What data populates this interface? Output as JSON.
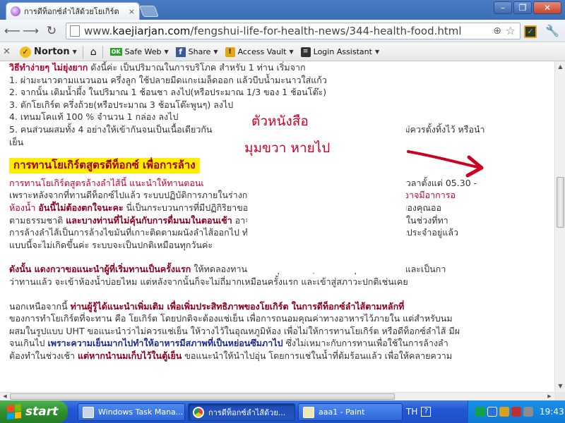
{
  "browser": {
    "tab_title": "การดีท็อกซ์ลำไส้ด้วยโยเกิร์ต",
    "tab_close": "×",
    "url_scheme": "www.",
    "url_host": "kaejiarjan.com",
    "url_path": "/fengshui-life-for-health-news/344-health-food.html",
    "win_min": "–",
    "win_max": "❐",
    "win_close": "✕"
  },
  "norton_toolbar": {
    "close": "✕",
    "brand": "Norton",
    "safe_web": "Safe Web",
    "share": "Share",
    "access_vault": "Access Vault",
    "login_assistant": "Login Assistant",
    "ok_badge": "OK",
    "fb_badge": "f"
  },
  "content": {
    "intro_lead": "วิธีทำง่ายๆ ไม่ยุ่งยาก",
    "intro_rest": " ดังนี้ค่ะ เป็นปริมาณในการบริโภค สำหรับ 1 ท่าน เริ่มจาก",
    "step1": "1. ผ่ามะนาวตามแนวนอน ครึ่งลูก ใช้ปลายมีดแกะเมล็ดออก แล้วบีบน้ำมะนาวใส่แก้ว",
    "step2": "2. จากนั้น เติมน้ำผึ้ง ในปริมาณ 1 ช้อนชา ลงไป(หรือประมาณ 1/3 ของ 1 ช้อนโต๊ะ)",
    "step3": "3. ตักโยเกิร์ต ครึ่งถ้วย(หรือประมาณ 3 ช้อนโต๊ะพูนๆ) ลงไป",
    "step4": "4. เทนมโคแท้ 100 % จำนวน 1 กล่อง ลงไป",
    "step5": "5. คนส่วนผสมทั้ง 4 อย่างให้เข้ากันจนเป็นเนื้อเดียวกัน",
    "step5_tail": "รทานทันทีไม่ควรตั้งทิ้งไว้ หรือนำ",
    "step5_cont": "เย็น",
    "heading": "การทานโยเกิร์ตสูตรดีท็อกซ์  เพื่อการล้าง",
    "p2_l1_a": "การทานโยเกิร์ตสูตรล้างลำไส้นี้  แนะนำให้ทานตอนเ",
    "p2_l1_b": "นแล้ว  ช่วงเวลาตั้งแต่  05.30 -",
    "p2_l2_a": "เพราะหลังจากที่ทานดีท็อกซ์ไปแล้ว    ระบบปฏิบัติการภายในร่างกายของแต่ละท่านจะไม่เหมือนกัน ",
    "p2_l2_b": "บางท่านอาจมีอาการอ",
    "p2_l3_a": "ห้องน้ำ ",
    "p2_l3_b": "อันนี้ไม่ต้องตกใจนะคะ",
    "p2_l3_c": "  นี่เป็นกระบวนการที่มีปฏิกิริยาของการดีท็อกซ์ลำไส้   ที่จะทำการขับของเสียของคุณออ",
    "p2_l4_a": "ตามธรรมชาติ ",
    "p2_l4_b": "และบางท่านที่ไม่คุ้นกับการดื่มนมในตอนเช้า",
    "p2_l4_c": " อาจมีการขับของเสียประมาณ 3-4 ครั้งต่อวัน ในช่วงที่ทา",
    "p2_l5": "การล้างลำไส้เป็นการล้างไขมันที่เกาะติดตามผนังลำไส้ออกไป  ทำให้ลำไส้สะอาดขึ้น  ส่วนท่านที่ทานนมเป็นประจำอยู่แล้ว",
    "p2_l6": "แบบนี้จะไม่เกิดขึ้นค่ะ ระบบจะเป็นปกติเหมือนทุกวันค่ะ",
    "p3_l1_a": "ดังนั้น แดงกวาขอแนะนำผู้ที่เริ่มทานเป็นครั้งแรก",
    "p3_l1_b": " ให้ทดลองทานในวันหยุดค่ะ แฮ่ๆ..จะได้ทำธุระได้สะดวก และเป็นกา",
    "p3_l2": "ว่าทานแล้ว จะเข้าห้องน้ำบ่อยไหม แต่หลังจากนั้นก็จะไม่ถี่มากเหมือนครั้งแรก และเข้าสู่สภาวะปกติเช่นเคย",
    "p4_l1_a": "นอกเหนือจากนี้ ",
    "p4_l1_b": "ท่านผู้รู้ได้แนะนำเพิ่มเติม   เพื่อเพิ่มประสิทธิภาพของโยเกิร์ต   ในการดีท็อกซ์ลำไส้ตามหลักที่",
    "p4_l2": "ของการทำโยเกิร์ตที่จะทาน คือ โยเกิร์ต โดยปกติจะต้องแช่เย็น เพื่อการถนอมคุณค่าทางอาหารไว้ภายใน แต่สำหรับนม",
    "p4_l3": "ผสมในรูปแบบ UHT ขอแนะนำว่าไม่ควรแช่เย็น ให้วางไว้ในอุณหภูมิห้อง เพื่อไม่ให้การทานโยเกิร์ต หรือดีท็อกซ์ลำไส้ มีผ",
    "p4_l4_a": "จนเกินไป ",
    "p4_l4_b": "เพราะความเย็นมากไปทำให้อาหารมีสภาพที่เป็นหย่อนซึมภาไป",
    "p4_l4_c": " ซึ่งไม่เหมาะกับการทานเพื่อใช้ในการล้างลำ",
    "p4_l5_a": "ต้องทำในช่วงเช้า ",
    "p4_l5_b": "แต่หากนำนมเก็บไว้ในตู้เย็น",
    "p4_l5_c": " ขอแนะนำให้นำไปอุ่น โดยการแช่ในน้ำที่ต้มร้อนแล้ว  เพื่อให้คลายความ"
  },
  "annotation": {
    "line1": "ตัวหนังสือ",
    "line2": "มุมขวา  หายไป",
    "color": "#cc0022"
  },
  "taskbar": {
    "start": "start",
    "task1": "Windows Task Mana...",
    "task2": "การดีท็อกซ์ลำไส้ด้วย...",
    "task3": "aaa1 - Paint",
    "lang": "TH",
    "help": "?",
    "clock": "19:43"
  }
}
